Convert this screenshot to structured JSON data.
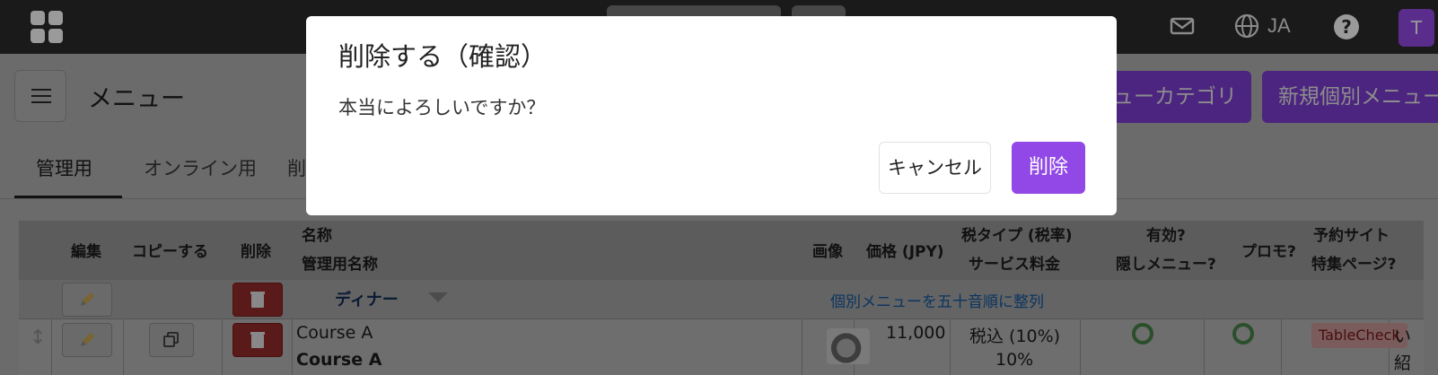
{
  "topbar": {
    "language": "JA",
    "help_label": "?",
    "avatar_initial": "T"
  },
  "header": {
    "title": "メニュー",
    "category_button": "ューカテゴリ",
    "new_item_button": "新規個別メニュー"
  },
  "tabs": [
    {
      "label": "管理用"
    },
    {
      "label": "オンライン用"
    },
    {
      "label": "削除"
    }
  ],
  "table": {
    "columns": {
      "edit": "編集",
      "copy": "コピーする",
      "delete": "削除",
      "name": "名称",
      "admin_name": "管理用名称",
      "image": "画像",
      "price": "価格 (JPY)",
      "tax_type": "税タイプ (税率)",
      "service_charge": "サービス料金",
      "active": "有効?",
      "hidden_menu": "隠しメニュー?",
      "promo": "プロモ?",
      "booking_site": "予約サイト",
      "feature_page": "特集ページ?"
    },
    "group": {
      "name": "ディナー",
      "sort_link": "個別メニューを五十音順に整列"
    },
    "rows": [
      {
        "name": "Course A",
        "admin_name": "Course A",
        "price": "11,000",
        "tax": "税込 (10%)",
        "service": "10%",
        "booking_badge": "TableCheck",
        "trailing_chars": [
          "い",
          "紹"
        ]
      }
    ]
  },
  "modal": {
    "title": "削除する（確認）",
    "message": "本当によろしいですか？",
    "cancel_label": "キャンセル",
    "delete_label": "削除"
  }
}
